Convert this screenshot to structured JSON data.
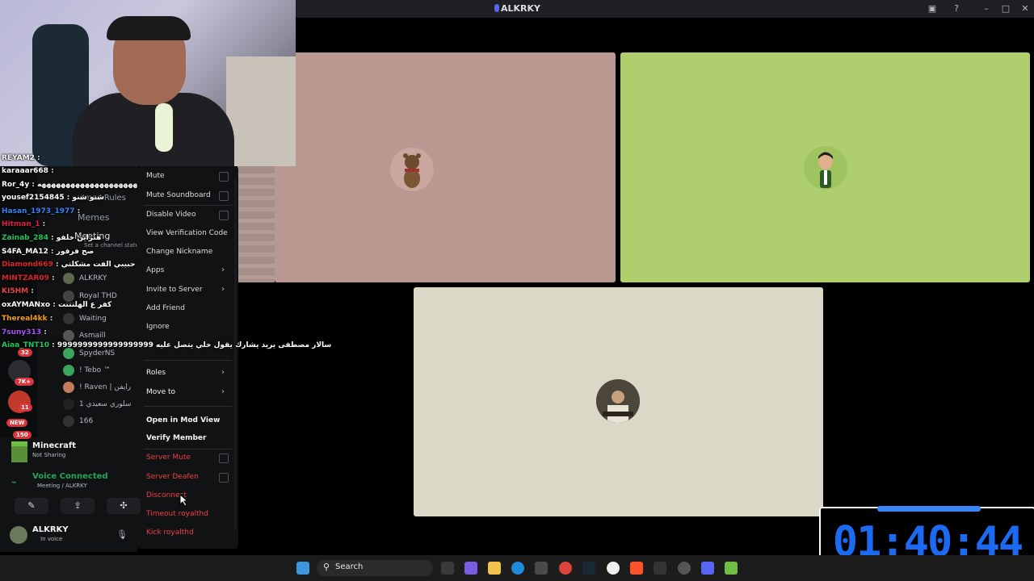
{
  "window": {
    "title": "ALKRKY",
    "controls": [
      "minimize",
      "maximize",
      "close"
    ]
  },
  "sidebar": {
    "channels": [
      "emes-Rules",
      "Memes",
      "Meeting"
    ],
    "channel_status_hint": "Set a channel status",
    "voice_members": [
      "ALKRKY",
      "Royal THD",
      "Waiting",
      "Asmaill",
      "SpyderNS",
      "! Tebo ™",
      "! Raven | رايفن",
      "سلوري سعيدي 1",
      "166"
    ],
    "badges": [
      "7K+",
      "11",
      "NEW",
      "150",
      "32"
    ]
  },
  "chat_overlay": [
    {
      "name": "REYAM2",
      "msg": "",
      "color": "#ffffff"
    },
    {
      "name": "karaaar668",
      "msg": "",
      "color": "#ffffff"
    },
    {
      "name": "Ror_4y",
      "msg": "ههههههههههههههههههههههههههه",
      "color": "#ffffff"
    },
    {
      "name": "yousef2154845",
      "msg": "شنو شنو",
      "color": "#ffffff"
    },
    {
      "name": "Hasan_1973_1977",
      "msg": "",
      "color": "#3b82f6"
    },
    {
      "name": "Hitman_1",
      "msg": "",
      "color": "#e11d48"
    },
    {
      "name": "Zainab_284",
      "msg": "هتراين خلفو",
      "color": "#22c55e"
    },
    {
      "name": "S4FA_MA12",
      "msg": "صح فرفور",
      "color": "#ffffff"
    },
    {
      "name": "Diamond669",
      "msg": "يا حبيبي الفت مشكلتي",
      "color": "#dc2626"
    },
    {
      "name": "MINTZAR09",
      "msg": "",
      "color": "#dc2626"
    },
    {
      "name": "KI5HM",
      "msg": "",
      "color": "#ef4444"
    },
    {
      "name": "oxAYMANxo",
      "msg": "كفر ع الهلتتتت",
      "color": "#ffffff"
    },
    {
      "name": "Thereal4kk",
      "msg": "",
      "color": "#f59e0b"
    },
    {
      "name": "7suny313",
      "msg": "",
      "color": "#a855f7"
    },
    {
      "name": "Aiaa_TNT10",
      "msg": "9999999999999999999 سالار مصطفى يريد يشارك يقول خلي يتصل عليه",
      "color": "#22c55e"
    }
  ],
  "context_menu": {
    "items": [
      {
        "label": "Mute",
        "type": "checkbox",
        "style": "normal"
      },
      {
        "label": "Mute Soundboard",
        "type": "checkbox",
        "style": "normal"
      },
      {
        "label": "Disable Video",
        "type": "checkbox",
        "style": "normal"
      },
      {
        "label": "View Verification Code",
        "type": "plain",
        "style": "normal"
      },
      {
        "label": "Change Nickname",
        "type": "plain",
        "style": "normal"
      },
      {
        "label": "Apps",
        "type": "submenu",
        "style": "normal"
      },
      {
        "label": "Invite to Server",
        "type": "submenu",
        "style": "normal"
      },
      {
        "label": "Add Friend",
        "type": "plain",
        "style": "normal"
      },
      {
        "label": "Ignore",
        "type": "plain",
        "style": "normal"
      },
      {
        "label": "Roles",
        "type": "submenu",
        "style": "bold"
      },
      {
        "label": "Move to",
        "type": "submenu",
        "style": "bold"
      },
      {
        "label": "Open in Mod View",
        "type": "plain",
        "style": "bold"
      },
      {
        "label": "Verify Member",
        "type": "plain",
        "style": "bold"
      },
      {
        "label": "Server Mute",
        "type": "checkbox",
        "style": "red"
      },
      {
        "label": "Server Deafen",
        "type": "checkbox",
        "style": "red"
      },
      {
        "label": "Disconnect",
        "type": "plain",
        "style": "red"
      },
      {
        "label": "Timeout royalthd",
        "type": "plain",
        "style": "red"
      },
      {
        "label": "Kick royalthd",
        "type": "plain",
        "style": "red"
      }
    ]
  },
  "game_panel": {
    "title": "Minecraft",
    "status": "Not Sharing"
  },
  "voice_panel": {
    "status": "Voice Connected",
    "channel": "Meeting / ALKRKY"
  },
  "user_panel": {
    "name": "ALKRKY",
    "status": "In voice"
  },
  "video_tiles": [
    {
      "name": "tile-bear",
      "bg": "#b89891"
    },
    {
      "name": "tile-man",
      "bg": "#afcf6e"
    },
    {
      "name": "tile-person",
      "bg": "#dcd8c8"
    }
  ],
  "timer": {
    "value": "01:40:44",
    "color": "#1d6af2"
  },
  "taskbar": {
    "search_placeholder": "Search"
  }
}
